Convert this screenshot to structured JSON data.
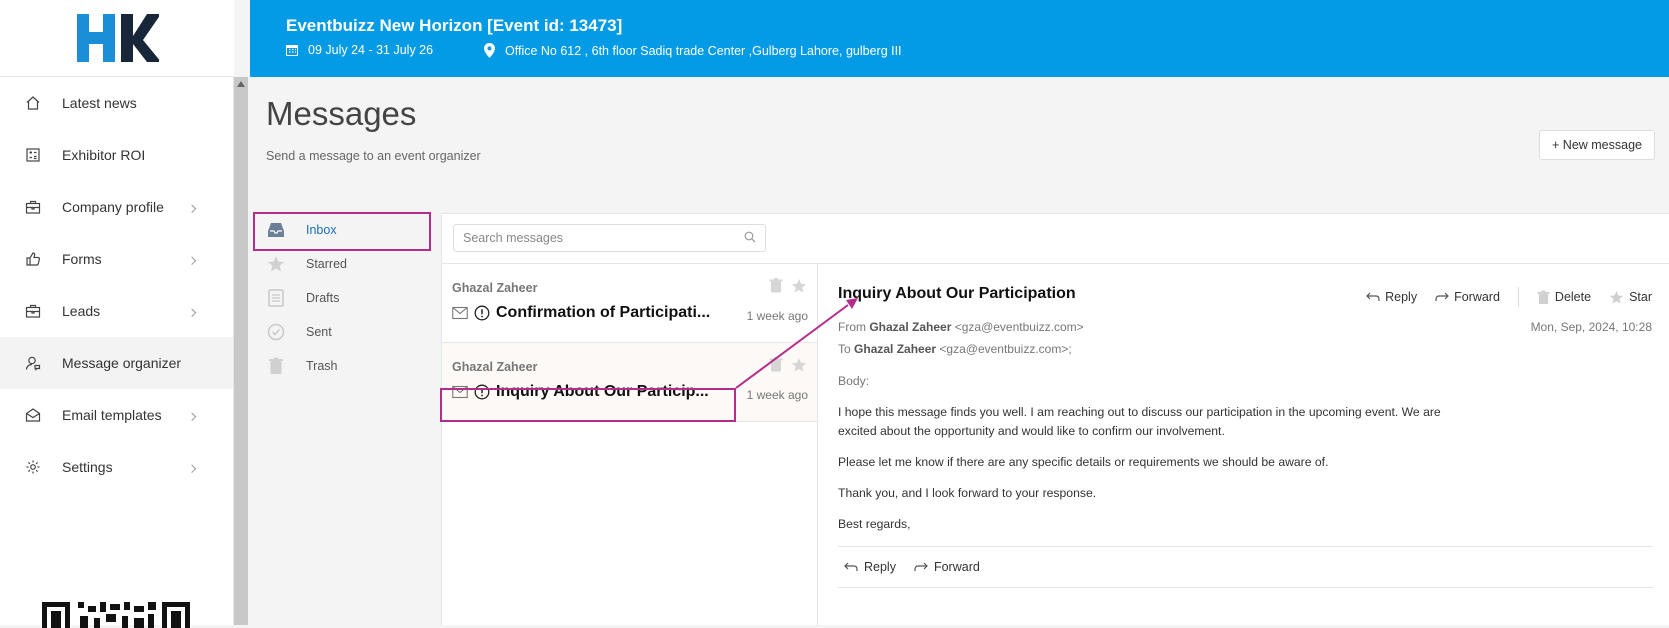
{
  "brand": {
    "logo_text": "HK",
    "accent": "#039be5",
    "highlight": "#b42d8a"
  },
  "event": {
    "title": "Eventbuizz New Horizon [Event id: 13473]",
    "dates": "09 July 24 - 31 July 26",
    "location": "Office No 612 , 6th floor Sadiq trade Center ,Gulberg Lahore, gulberg III"
  },
  "sidebar": {
    "items": [
      {
        "label": "Latest news",
        "icon": "home-icon"
      },
      {
        "label": "Exhibitor ROI",
        "icon": "calculator-icon"
      },
      {
        "label": "Company profile",
        "icon": "briefcase-icon"
      },
      {
        "label": "Forms",
        "icon": "thumbs-up-icon"
      },
      {
        "label": "Leads",
        "icon": "briefcase-icon"
      },
      {
        "label": "Message organizer",
        "icon": "user-chat-icon"
      },
      {
        "label": "Email templates",
        "icon": "envelope-open-icon"
      },
      {
        "label": "Settings",
        "icon": "gear-icon"
      }
    ]
  },
  "page": {
    "title": "Messages",
    "subtitle": "Send a message to an event organizer",
    "new_button": "+ New message"
  },
  "folders": [
    {
      "label": "Inbox",
      "icon": "inbox-icon"
    },
    {
      "label": "Starred",
      "icon": "star-icon"
    },
    {
      "label": "Drafts",
      "icon": "document-icon"
    },
    {
      "label": "Sent",
      "icon": "check-circle-icon"
    },
    {
      "label": "Trash",
      "icon": "trash-icon"
    }
  ],
  "search": {
    "placeholder": "Search messages"
  },
  "messages": [
    {
      "sender": "Ghazal Zaheer",
      "subject": "Confirmation of Participati...",
      "time": "1 week ago"
    },
    {
      "sender": "Ghazal Zaheer",
      "subject": "Inquiry About Our Particip...",
      "time": "1 week ago"
    }
  ],
  "reader": {
    "subject": "Inquiry About Our Participation",
    "actions": {
      "reply": "Reply",
      "forward": "Forward",
      "delete": "Delete",
      "star": "Star"
    },
    "from_label": "From",
    "from_name": "Ghazal Zaheer",
    "from_email": "<gza@eventbuizz.com>",
    "to_label": "To",
    "to_name": "Ghazal Zaheer",
    "to_email": "<gza@eventbuizz.com>;",
    "date": "Mon, Sep, 2024, 10:28",
    "body_label": "Body:",
    "body_1": "I hope this message finds you well. I am reaching out to discuss our participation in the upcoming event. We are excited about the opportunity and would like to confirm our involvement.",
    "body_2": "Please let me know if there are any specific details or requirements we should be aware of.",
    "body_3": "Thank you, and I look forward to your response.",
    "body_4": "Best regards,",
    "footer": {
      "reply": "Reply",
      "forward": "Forward"
    }
  }
}
